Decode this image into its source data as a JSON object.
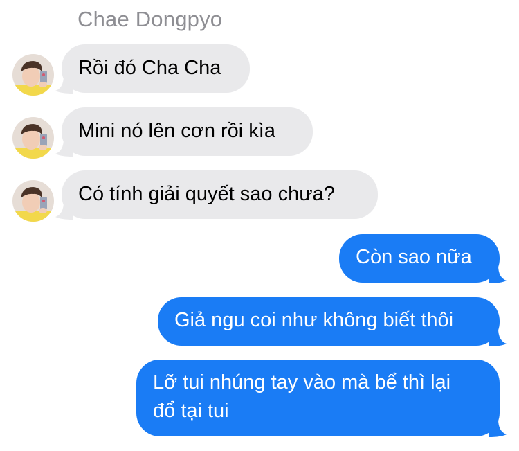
{
  "conversation": {
    "sender_name": "Chae Dongpyo",
    "incoming": [
      {
        "text": "Rồi đó Cha Cha"
      },
      {
        "text": "Mini nó lên cơn rồi kìa"
      },
      {
        "text": "Có tính giải quyết sao chưa?"
      }
    ],
    "outgoing": [
      {
        "text": "Còn sao nữa"
      },
      {
        "text": "Giả ngu coi như không biết thôi"
      },
      {
        "lines": [
          "Lỡ tui nhúng tay vào mà bể thì lại",
          "đổ tại tui"
        ]
      }
    ]
  },
  "colors": {
    "incoming_bubble": "#e9e9eb",
    "outgoing_bubble": "#1a7cf5",
    "sender_name": "#8e8e93"
  },
  "icons": {
    "avatar": "contact-avatar-photo"
  }
}
